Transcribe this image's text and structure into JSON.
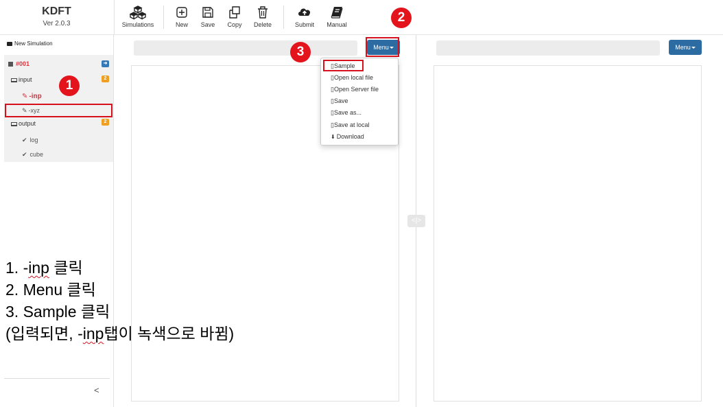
{
  "app": {
    "title": "KDFT",
    "version": "Ver 2.0.3"
  },
  "toolbar": {
    "simulations": "Simulations",
    "new": "New",
    "save": "Save",
    "copy": "Copy",
    "delete": "Delete",
    "submit": "Submit",
    "manual": "Manual"
  },
  "sidebar": {
    "new_simulation": "New Simulation",
    "simulation_id": "#001",
    "input_label": "input",
    "input_count": "2",
    "input_items": [
      "-inp",
      "-xyz"
    ],
    "output_label": "output",
    "output_count": "2",
    "output_items": [
      "log",
      "cube"
    ],
    "collapse_glyph": "<"
  },
  "panels": {
    "left_menu_label": "Menu",
    "right_menu_label": "Menu",
    "split_glyph": "<|>"
  },
  "dropdown": {
    "items": [
      "Sample",
      "Open local file",
      "Open Server file",
      "Save",
      "Save as...",
      "Save at local",
      "Download"
    ]
  },
  "annotations": {
    "step_numbers": [
      "1",
      "2",
      "3"
    ],
    "line1_prefix": "1. -",
    "line1_word": "inp",
    "line1_suffix": " 클릭",
    "line2": "2. Menu 클릭",
    "line3": "3. Sample 클릭",
    "line4_prefix": "(입력되면, -",
    "line4_word": "inp",
    "line4_suffix": "탭이 녹색으로 바뀜)"
  },
  "colors": {
    "accent_red": "#d6111b",
    "menu_blue": "#2d6ca2",
    "badge_orange": "#f0a020",
    "active_red": "#d9333f"
  }
}
